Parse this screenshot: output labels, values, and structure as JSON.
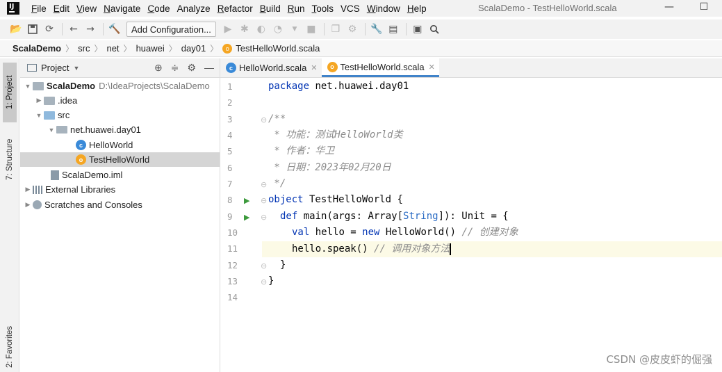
{
  "menubar": {
    "items": [
      {
        "label": "File",
        "ul": "F",
        "rest": "ile"
      },
      {
        "label": "Edit",
        "ul": "E",
        "rest": "dit"
      },
      {
        "label": "View",
        "ul": "V",
        "rest": "iew"
      },
      {
        "label": "Navigate",
        "ul": "N",
        "rest": "avigate"
      },
      {
        "label": "Code",
        "ul": "C",
        "rest": "ode"
      },
      {
        "label": "Analyze",
        "ul": "",
        "rest": "Analyze"
      },
      {
        "label": "Refactor",
        "ul": "R",
        "rest": "efactor"
      },
      {
        "label": "Build",
        "ul": "B",
        "rest": "uild"
      },
      {
        "label": "Run",
        "ul": "R",
        "rest": "un"
      },
      {
        "label": "Tools",
        "ul": "T",
        "rest": "ools"
      },
      {
        "label": "VCS",
        "ul": "",
        "rest": "VCS"
      },
      {
        "label": "Window",
        "ul": "W",
        "rest": "indow"
      },
      {
        "label": "Help",
        "ul": "H",
        "rest": "elp"
      }
    ],
    "window_title": "ScalaDemo - TestHelloWorld.scala",
    "minimize": "—",
    "maximize": "☐"
  },
  "toolbar": {
    "add_configuration": "Add Configuration..."
  },
  "breadcrumb": [
    "ScalaDemo",
    "src",
    "net",
    "huawei",
    "day01",
    "TestHelloWorld.scala"
  ],
  "sidebar": {
    "project_tab": "1: Project",
    "structure_tab": "7: Structure",
    "favorites_tab": "2: Favorites"
  },
  "project": {
    "header": "Project",
    "tree": [
      {
        "label": "ScalaDemo",
        "path": "D:\\IdeaProjects\\ScalaDemo"
      },
      {
        "label": ".idea"
      },
      {
        "label": "src"
      },
      {
        "label": "net.huawei.day01"
      },
      {
        "label": "HelloWorld"
      },
      {
        "label": "TestHelloWorld"
      },
      {
        "label": "ScalaDemo.iml"
      },
      {
        "label": "External Libraries"
      },
      {
        "label": "Scratches and Consoles"
      }
    ]
  },
  "editor": {
    "tabs": [
      {
        "label": "HelloWorld.scala"
      },
      {
        "label": "TestHelloWorld.scala"
      }
    ],
    "line_numbers": [
      "1",
      "2",
      "3",
      "4",
      "5",
      "6",
      "7",
      "8",
      "9",
      "10",
      "11",
      "12",
      "13",
      "14"
    ],
    "code": {
      "l1_kw": "package",
      "l1_rest": " net.huawei.day01",
      "l3": "/**",
      "l4": " * 功能：测试HelloWorld类",
      "l5": " * 作者：华卫",
      "l6": " * 日期：2023年02月20日",
      "l7": " */",
      "l8_kw": "object",
      "l8_rest": " TestHelloWorld {",
      "l9_kw": "def",
      "l9_a": " main(args: Array[",
      "l9_type": "String",
      "l9_b": "]): Unit = {",
      "l10_kw1": "val",
      "l10_a": " hello = ",
      "l10_kw2": "new",
      "l10_b": " HelloWorld() ",
      "l10_cm": "// 创建对象",
      "l11_a": "hello.speak() ",
      "l11_cm": "// 调用对象方法",
      "l12": "}",
      "l13": "}"
    }
  },
  "watermark": "CSDN @皮皮虾的倔强",
  "colors": {
    "keyword": "#0033b3",
    "comment": "#8c8c8c",
    "active_tab_underline": "#4083c9",
    "current_line": "#fcfae6"
  }
}
